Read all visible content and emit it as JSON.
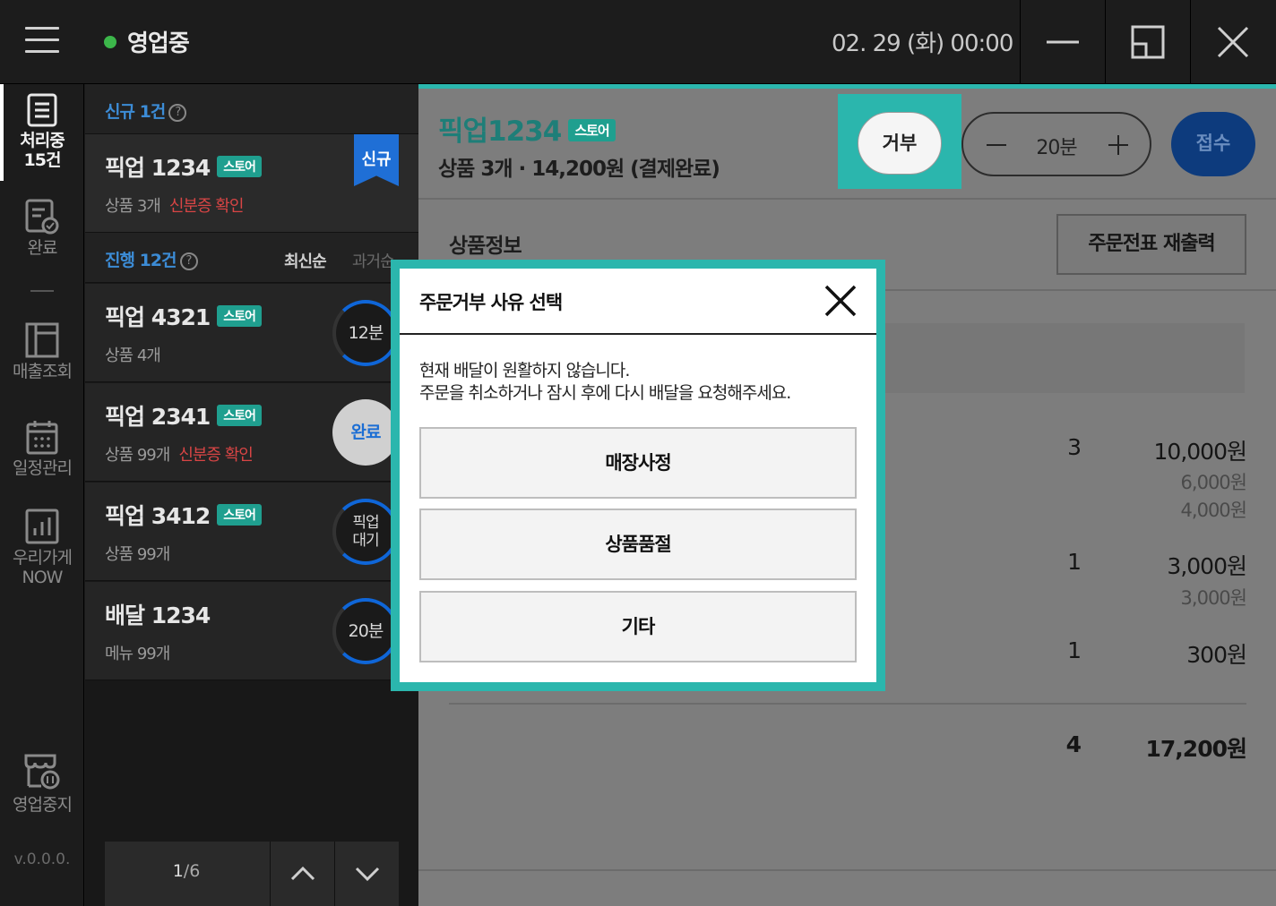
{
  "topbar": {
    "status": "영업중",
    "status_color": "#3cb64a",
    "datetime": "02. 29 (화) 00:00"
  },
  "nav": {
    "items": [
      {
        "label": "처리중",
        "count": "15건"
      },
      {
        "label": "완료"
      },
      {
        "label": "매출조회"
      },
      {
        "label": "일정관리"
      },
      {
        "label": "우리가게",
        "sub": "NOW"
      },
      {
        "label": "영업중지"
      }
    ],
    "version": "v.0.0.0."
  },
  "orderlist": {
    "new_section": {
      "title": "신규 1건"
    },
    "progress_section": {
      "title": "진행 12건",
      "sort_latest": "최신순",
      "sort_oldest": "과거순"
    },
    "cards": [
      {
        "title": "픽업 1234",
        "tag": "스토어",
        "items": "상품 3개",
        "warn": "신분증 확인",
        "ribbon": "신규"
      },
      {
        "title": "픽업 4321",
        "tag": "스토어",
        "items": "상품 4개",
        "timer": "12분"
      },
      {
        "title": "픽업 2341",
        "tag": "스토어",
        "items": "상품 99개",
        "warn": "신분증 확인",
        "timer": "완료"
      },
      {
        "title": "픽업 3412",
        "tag": "스토어",
        "items": "상품 99개",
        "timer_line1": "픽업",
        "timer_line2": "대기"
      },
      {
        "title": "배달 1234",
        "items": "메뉴 99개",
        "timer": "20분"
      }
    ],
    "pager": {
      "current": "1",
      "total": "/6"
    }
  },
  "detail": {
    "title": "픽업1234",
    "tag": "스토어",
    "subtitle": "상품 3개 · 14,200원 (결제완료)",
    "reject_label": "거부",
    "time_value": "20분",
    "accept_label": "접수",
    "section_label": "상품정보",
    "reprint_label": "주문전표 재출력",
    "items": [
      {
        "qty": "3",
        "price": "10,000원",
        "options": [
          "6,000원",
          "4,000원"
        ]
      },
      {
        "qty": "1",
        "price": "3,000원",
        "options": [
          "3,000원"
        ]
      },
      {
        "qty": "1",
        "price": "300원",
        "options": []
      }
    ],
    "total": {
      "qty": "4",
      "price": "17,200원"
    }
  },
  "modal": {
    "title": "주문거부 사유 선택",
    "message_line1": "현재 배달이 원활하지 않습니다.",
    "message_line2": "주문을 취소하거나 잠시 후에 다시 배달을 요청해주세요.",
    "reasons": [
      "매장사정",
      "상품품절",
      "기타"
    ]
  },
  "colors": {
    "accent": "#2bb6ad",
    "brand_blue": "#1f6fd6",
    "warning": "#d84545"
  }
}
